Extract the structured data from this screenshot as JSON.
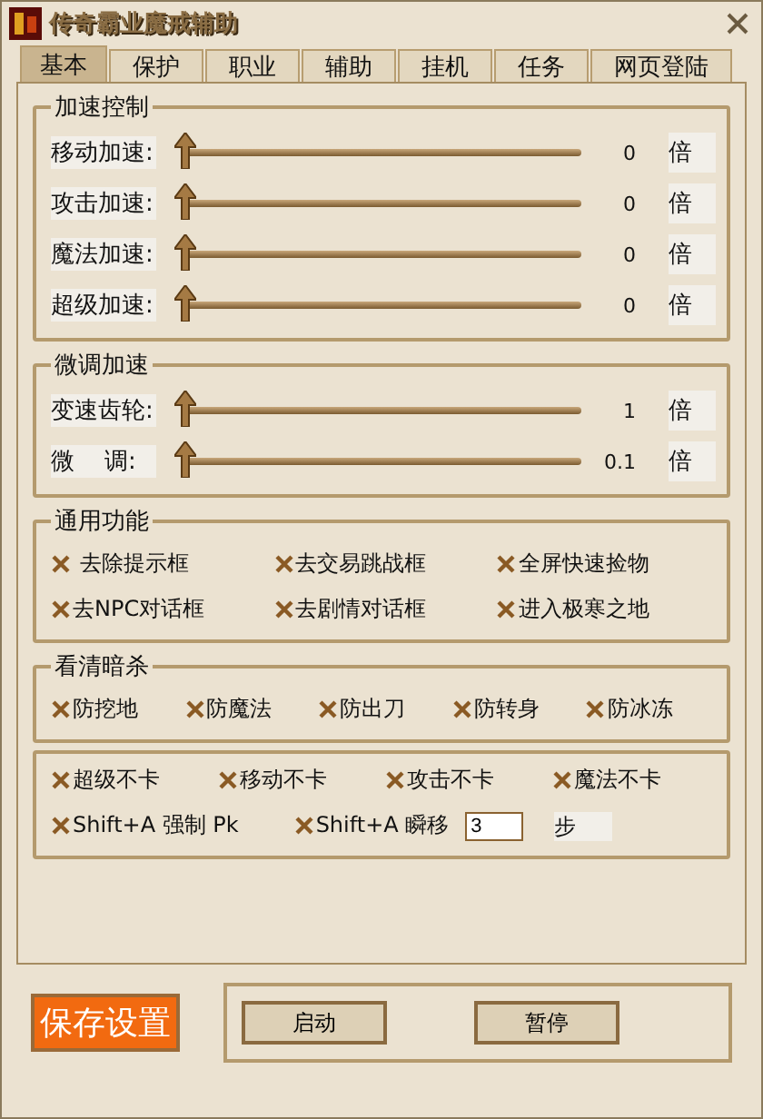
{
  "window": {
    "title": "传奇霸业魔戒辅助"
  },
  "tabs": [
    {
      "label": "基本",
      "selected": true
    },
    {
      "label": "保护",
      "selected": false
    },
    {
      "label": "职业",
      "selected": false
    },
    {
      "label": "辅助",
      "selected": false
    },
    {
      "label": "挂机",
      "selected": false
    },
    {
      "label": "任务",
      "selected": false
    },
    {
      "label": "网页登陆",
      "selected": false
    }
  ],
  "groups": [
    {
      "title": "加速控制",
      "kind": "sliders",
      "rows": [
        {
          "label": "移动加速:",
          "level": 0,
          "reading": "0",
          "unit": "倍"
        },
        {
          "label": "攻击加速:",
          "level": 0,
          "reading": "0",
          "unit": "倍"
        },
        {
          "label": "魔法加速:",
          "level": 0,
          "reading": "0",
          "unit": "倍"
        },
        {
          "label": "超级加速:",
          "level": 0,
          "reading": "0",
          "unit": "倍"
        }
      ]
    },
    {
      "title": "微调加速",
      "kind": "sliders",
      "rows": [
        {
          "label": "变速齿轮:",
          "level": 0,
          "reading": "1",
          "unit": "倍"
        },
        {
          "label": "微    调:",
          "level": 0,
          "reading": "0.1",
          "unit": "倍"
        }
      ]
    },
    {
      "title": "通用功能",
      "kind": "checks",
      "lines": [
        {
          "items": [
            {
              "kind": "check",
              "label": " 去除提示框",
              "checked": true
            },
            {
              "kind": "check",
              "label": "去交易跳战框",
              "checked": true
            },
            {
              "kind": "check",
              "label": "全屏快速捡物",
              "checked": true
            }
          ]
        },
        {
          "items": [
            {
              "kind": "check",
              "label": "去NPC对话框",
              "checked": true
            },
            {
              "kind": "check",
              "label": "去剧情对话框",
              "checked": true
            },
            {
              "kind": "check",
              "label": "进入极寒之地",
              "checked": true
            }
          ]
        }
      ]
    },
    {
      "title": "看清暗杀",
      "kind": "checks",
      "lines": [
        {
          "items": [
            {
              "kind": "check",
              "label": "防挖地",
              "checked": true
            },
            {
              "kind": "check",
              "label": "防魔法",
              "checked": true
            },
            {
              "kind": "check",
              "label": "防出刀",
              "checked": true
            },
            {
              "kind": "check",
              "label": "防转身",
              "checked": true
            },
            {
              "kind": "check",
              "label": "防冰冻",
              "checked": true
            }
          ]
        }
      ]
    },
    {
      "kind": "checks",
      "lines": [
        {
          "items": [
            {
              "kind": "check",
              "label": "超级不卡",
              "checked": true
            },
            {
              "kind": "check",
              "label": "移动不卡",
              "checked": true
            },
            {
              "kind": "check",
              "label": "攻击不卡",
              "checked": true
            },
            {
              "kind": "check",
              "label": "魔法不卡",
              "checked": true
            }
          ]
        },
        {
          "items": [
            {
              "kind": "check",
              "label": "Shift+A 强制 Pk",
              "checked": true
            },
            {
              "kind": "check_field",
              "label": "Shift+A 瞬移",
              "checked": true,
              "field": "3",
              "unit": "步"
            }
          ]
        }
      ]
    }
  ],
  "save_button": "保存设置",
  "buttons": [
    "启动",
    "暂停"
  ]
}
